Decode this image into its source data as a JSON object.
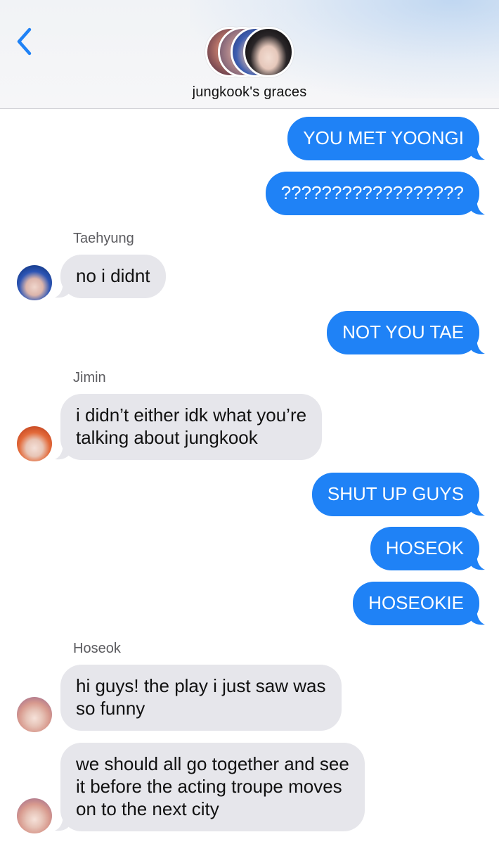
{
  "header": {
    "back_icon": "chevron-left-icon",
    "group_name": "jungkook's graces",
    "accent": "#1f82f6"
  },
  "messages": [
    {
      "from": "me",
      "lines": [
        "YOU MET YOONGI"
      ]
    },
    {
      "from": "me",
      "lines": [
        "??????????????????"
      ]
    },
    {
      "from": "Taehyung",
      "sender_label": "Taehyung",
      "lines": [
        "no i didnt"
      ]
    },
    {
      "from": "me",
      "lines": [
        "NOT YOU TAE"
      ]
    },
    {
      "from": "Jimin",
      "sender_label": "Jimin",
      "lines": [
        "i didn’t either idk what you’re",
        "talking about jungkook"
      ]
    },
    {
      "from": "me",
      "lines": [
        "SHUT UP GUYS"
      ]
    },
    {
      "from": "me",
      "lines": [
        "HOSEOK"
      ]
    },
    {
      "from": "me",
      "lines": [
        "HOSEOKIE"
      ]
    },
    {
      "from": "Hoseok",
      "sender_label": "Hoseok",
      "lines": [
        "hi guys! the play i just saw was",
        "so funny"
      ]
    },
    {
      "from": "Hoseok",
      "lines": [
        "we should all go together and see",
        "it before the acting troupe moves",
        "on to the next city"
      ]
    }
  ],
  "colors": {
    "sent_bubble": "#1f82f6",
    "received_bubble": "#e6e6eb",
    "sender_label": "#5c5c60"
  }
}
